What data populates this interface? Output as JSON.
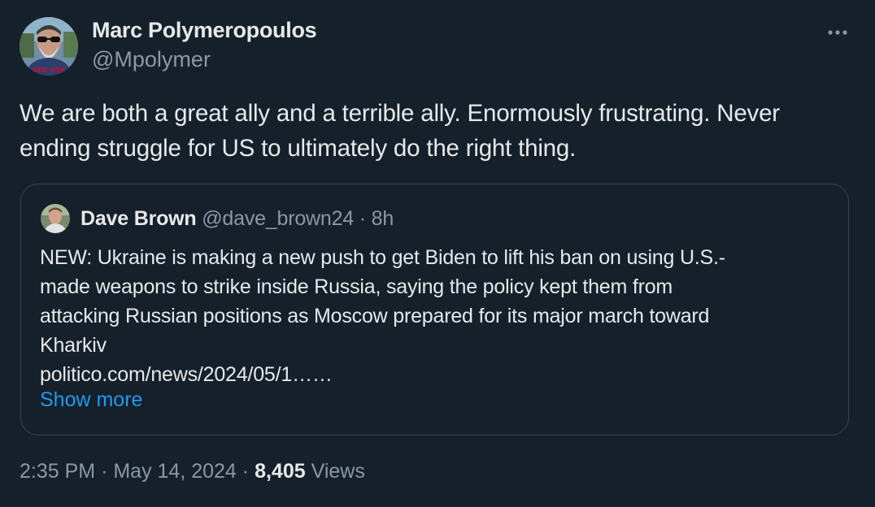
{
  "author": {
    "name": "Marc Polymeropoulos",
    "handle": "@Mpolymer",
    "avatar": "avatar-photo-man-with-sunglasses-red-sox-shirt",
    "avatar_shirt_text": "RED SOX"
  },
  "more_icon": "more-horizontal-icon",
  "tweet": {
    "text_lines": [
      "We are both a great ally and a terrible ally.  Enormously frustrating.  Never",
      "ending struggle for US to ultimately do the right thing."
    ]
  },
  "quote": {
    "name": "Dave Brown",
    "handle": "@dave_brown24",
    "separator": "·",
    "time": "8h",
    "avatar": "avatar-photo-man",
    "text_lines": [
      "NEW: Ukraine is making a new push to get Biden to lift his ban on using U.S.-",
      "made weapons to strike inside Russia, saying the policy kept them from",
      "attacking Russian positions as Moscow prepared for its major march toward",
      "Kharkiv",
      "politico.com/news/2024/05/1……"
    ],
    "show_more": "Show more"
  },
  "meta": {
    "time": "2:35 PM",
    "sep1": "·",
    "date": "May 14, 2024",
    "sep2": "·",
    "views_count": "8,405",
    "views_label": "Views"
  },
  "colors": {
    "background": "#15202b",
    "text": "#e7e9ea",
    "secondary": "#8b98a5",
    "link": "#1d9bf0",
    "border": "#38444d"
  }
}
